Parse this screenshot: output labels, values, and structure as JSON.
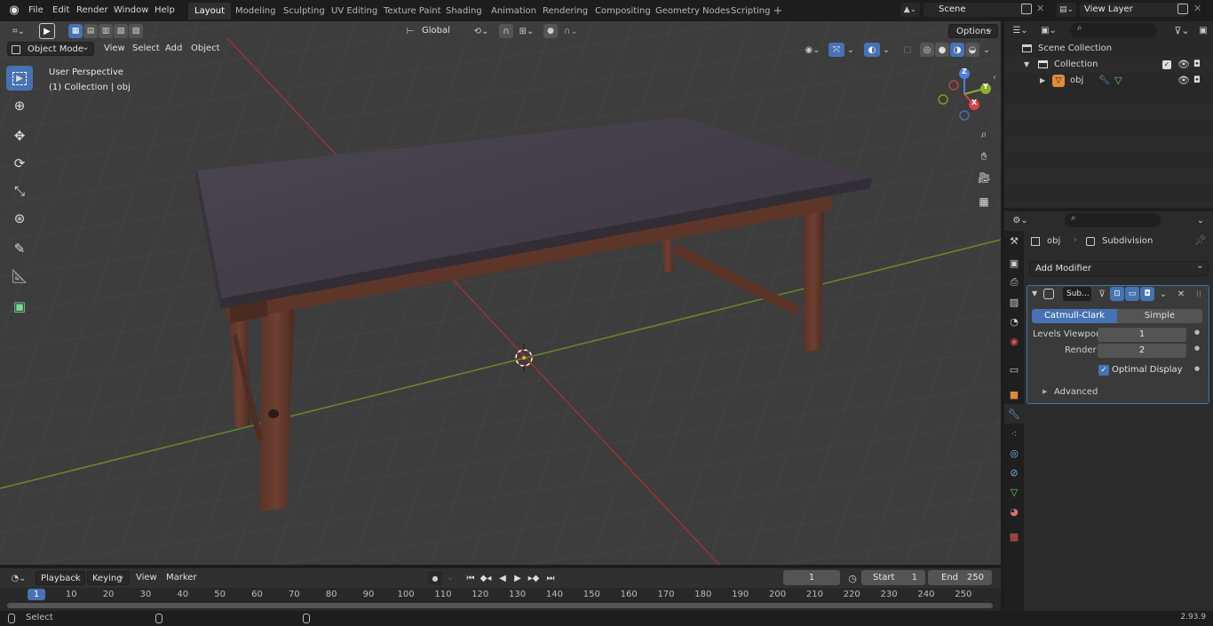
{
  "menu": [
    "File",
    "Edit",
    "Render",
    "Window",
    "Help"
  ],
  "workspaces": [
    "Layout",
    "Modeling",
    "Sculpting",
    "UV Editing",
    "Texture Paint",
    "Shading",
    "Animation",
    "Rendering",
    "Compositing",
    "Geometry Nodes",
    "Scripting"
  ],
  "active_workspace": "Layout",
  "scene_name": "Scene",
  "view_layer": "View Layer",
  "viewport": {
    "mode": "Object Mode",
    "menus": [
      "View",
      "Select",
      "Add",
      "Object"
    ],
    "orientation": "Global",
    "options_label": "Options",
    "overlay_title": "User Perspective",
    "overlay_sub": "(1) Collection | obj",
    "gizmo_axes": [
      "Z",
      "Y",
      "X"
    ]
  },
  "outliner": {
    "scene_collection": "Scene Collection",
    "collection": "Collection",
    "object": "obj"
  },
  "properties": {
    "object": "obj",
    "modifier_breadcrumb": "Subdivision",
    "add_modifier": "Add Modifier",
    "modifier_name": "Sub...",
    "catmull": "Catmull-Clark",
    "simple": "Simple",
    "levels_label": "Levels Viewport",
    "levels_value": "1",
    "render_label": "Render",
    "render_value": "2",
    "optimal_label": "Optimal Display",
    "optimal_checked": true,
    "advanced": "Advanced"
  },
  "timeline": {
    "menus": [
      "Playback",
      "Keying",
      "View",
      "Marker"
    ],
    "current_frame": "1",
    "start_label": "Start",
    "start": "1",
    "end_label": "End",
    "end": "250",
    "ticks": [
      "1",
      "10",
      "20",
      "30",
      "40",
      "50",
      "60",
      "70",
      "80",
      "90",
      "100",
      "110",
      "120",
      "130",
      "140",
      "150",
      "160",
      "170",
      "180",
      "190",
      "200",
      "210",
      "220",
      "230",
      "240",
      "250"
    ]
  },
  "status": {
    "left": "Select",
    "version": "2.93.9"
  },
  "colors": {
    "accent": "#4772b3",
    "x_axis": "#9b3434",
    "y_axis": "#6a8a2a"
  }
}
